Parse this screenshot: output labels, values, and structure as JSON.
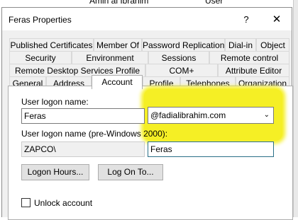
{
  "background": {
    "partial_text_1": "Amin al Ibrahim",
    "partial_text_2": "User"
  },
  "window": {
    "title": "Feras Properties",
    "help_label": "?",
    "close_label": "✕"
  },
  "tabs": {
    "row1": [
      "Published Certificates",
      "Member Of",
      "Password Replication",
      "Dial-in",
      "Object"
    ],
    "row2": [
      "Security",
      "Environment",
      "Sessions",
      "Remote control"
    ],
    "row3": [
      "Remote Desktop Services Profile",
      "COM+",
      "Attribute Editor"
    ],
    "row4": [
      "General",
      "Address",
      "Account",
      "Profile",
      "Telephones",
      "Organization"
    ],
    "active": "Account"
  },
  "account": {
    "logon_name_label": "User logon name:",
    "logon_name_value": "Feras",
    "domain_value": "@fadialibrahim.com",
    "pre2000_label": "User logon name (pre-Windows 2000):",
    "pre2000_domain": "ZAPCO\\",
    "pre2000_name": "Feras",
    "logon_hours_button": "Logon Hours...",
    "log_on_to_button": "Log On To...",
    "unlock_label": "Unlock account",
    "unlock_checked": false
  },
  "colors": {
    "highlight": "#f5ef1a",
    "focus_border": "#0078d7"
  }
}
